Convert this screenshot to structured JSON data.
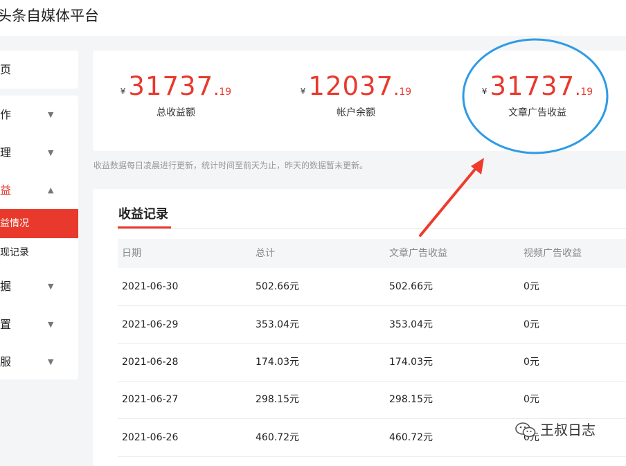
{
  "header": {
    "title": "头条自媒体平台"
  },
  "sidebar": {
    "home": "页",
    "items": [
      {
        "label": "作"
      },
      {
        "label": "理"
      },
      {
        "label": "益"
      },
      {
        "label": "据"
      },
      {
        "label": "置"
      },
      {
        "label": "服"
      }
    ],
    "sub_items": [
      {
        "label": "益情况"
      },
      {
        "label": "现记录"
      }
    ]
  },
  "stats": [
    {
      "currency": "¥",
      "integer": "31737",
      "dot": ".",
      "decimal": "19",
      "caption": "总收益额"
    },
    {
      "currency": "¥",
      "integer": "12037",
      "dot": ".",
      "decimal": "19",
      "caption": "帐户余额"
    },
    {
      "currency": "¥",
      "integer": "31737",
      "dot": ".",
      "decimal": "19",
      "caption": "文章广告收益"
    }
  ],
  "note": "收益数据每日凌晨进行更新，统计时间至前天为止，昨天的数据暂未更新。",
  "records": {
    "title": "收益记录",
    "headers": [
      "日期",
      "总计",
      "文章广告收益",
      "视频广告收益"
    ],
    "rows": [
      [
        "2021-06-30",
        "502.66元",
        "502.66元",
        "0元"
      ],
      [
        "2021-06-29",
        "353.04元",
        "353.04元",
        "0元"
      ],
      [
        "2021-06-28",
        "174.03元",
        "174.03元",
        "0元"
      ],
      [
        "2021-06-27",
        "298.15元",
        "298.15元",
        "0元"
      ],
      [
        "2021-06-26",
        "460.72元",
        "460.72元",
        "0元"
      ]
    ]
  },
  "watermark": {
    "text": "王叔日志"
  },
  "colors": {
    "accent": "#e8392c",
    "annotation_circle": "#2e9be6"
  },
  "icons": {
    "collapsed": "chevron-down-icon",
    "expanded": "chevron-up-icon",
    "watermark": "wechat-icon"
  }
}
